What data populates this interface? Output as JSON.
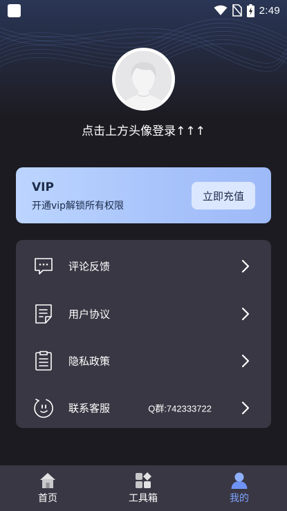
{
  "status_bar": {
    "time": "2:49"
  },
  "profile": {
    "login_prompt": "点击上方头像登录↑↑↑"
  },
  "vip_card": {
    "title": "VIP",
    "subtitle": "开通vip解锁所有权限",
    "button_label": "立即充值"
  },
  "menu": {
    "items": [
      {
        "label": "评论反馈",
        "icon": "comment-icon",
        "value": ""
      },
      {
        "label": "用户协议",
        "icon": "document-icon",
        "value": ""
      },
      {
        "label": "隐私政策",
        "icon": "clipboard-icon",
        "value": ""
      },
      {
        "label": "联系客服",
        "icon": "customer-service-icon",
        "value": "Q群:742333722"
      }
    ]
  },
  "tab_bar": {
    "tabs": [
      {
        "label": "首页",
        "icon": "home-icon",
        "active": false
      },
      {
        "label": "工具箱",
        "icon": "toolbox-icon",
        "active": false
      },
      {
        "label": "我的",
        "icon": "profile-icon",
        "active": true
      }
    ]
  },
  "colors": {
    "background": "#1c1b21",
    "card": "#393743",
    "vip_gradient_start": "#bcd5ff",
    "vip_gradient_end": "#9db9f8",
    "active_tab": "#7ea2ff"
  }
}
